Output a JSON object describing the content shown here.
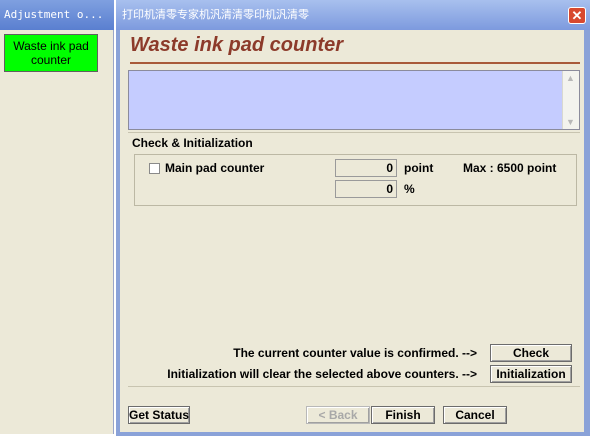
{
  "left_window": {
    "title": "Adjustment o...",
    "nav_items": [
      {
        "label": "Waste ink pad counter",
        "color": "#00ff00"
      }
    ]
  },
  "dialog": {
    "title": "打印机清零专家机汎清清零印机汎清零",
    "close_icon": "close-icon",
    "heading": "Waste ink pad counter",
    "message_text": "",
    "group_title": "Check & Initialization",
    "counter": {
      "label": "Main pad counter",
      "checked": false,
      "value_point": "0",
      "unit_point": "point",
      "value_percent": "0",
      "unit_percent": "%",
      "max_text": "Max : 6500 point"
    },
    "check_message": "The current counter value is confirmed. -->",
    "check_button": "Check",
    "init_message": "Initialization will clear the selected above counters. -->",
    "init_button": "Initialization",
    "footer": {
      "get_status": "Get Status",
      "back": "< Back",
      "finish": "Finish",
      "cancel": "Cancel"
    }
  }
}
